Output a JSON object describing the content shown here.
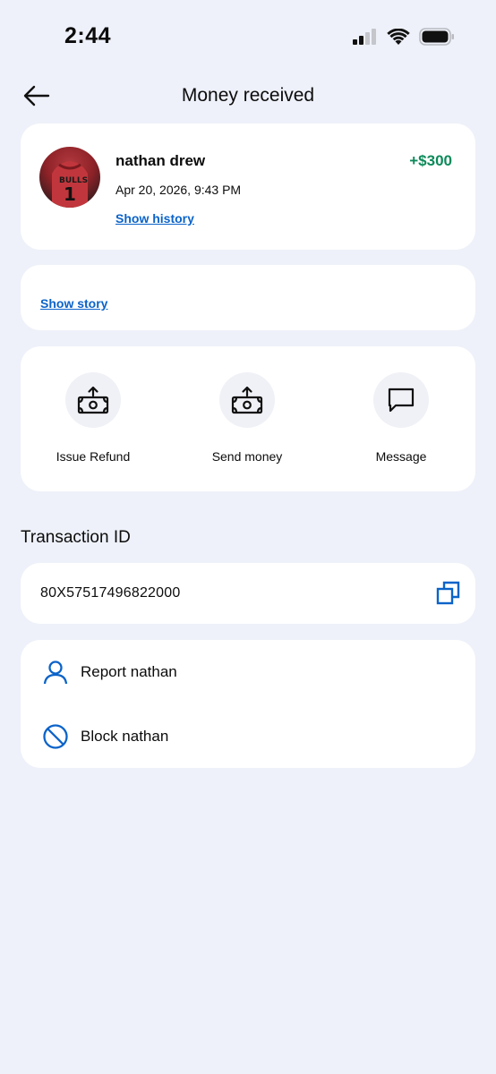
{
  "status_bar": {
    "time": "2:44"
  },
  "header": {
    "title": "Money received"
  },
  "transaction": {
    "sender_name": "nathan drew",
    "date": "Apr 20, 2026, 9:43 PM",
    "amount": "+$300",
    "show_history_label": "Show history",
    "show_story_label": "Show story"
  },
  "actions": [
    {
      "label": "Issue Refund",
      "icon": "cash-icon"
    },
    {
      "label": "Send money",
      "icon": "cash-icon"
    },
    {
      "label": "Message",
      "icon": "message-icon"
    }
  ],
  "transaction_id": {
    "heading": "Transaction ID",
    "value": "80X57517496822000"
  },
  "menu": {
    "report_label": "Report nathan",
    "block_label": "Block nathan"
  },
  "colors": {
    "background": "#eef1f9",
    "link": "#0b63c9",
    "amount_positive": "#0d8a5a",
    "icon_blue": "#0b63c9"
  }
}
